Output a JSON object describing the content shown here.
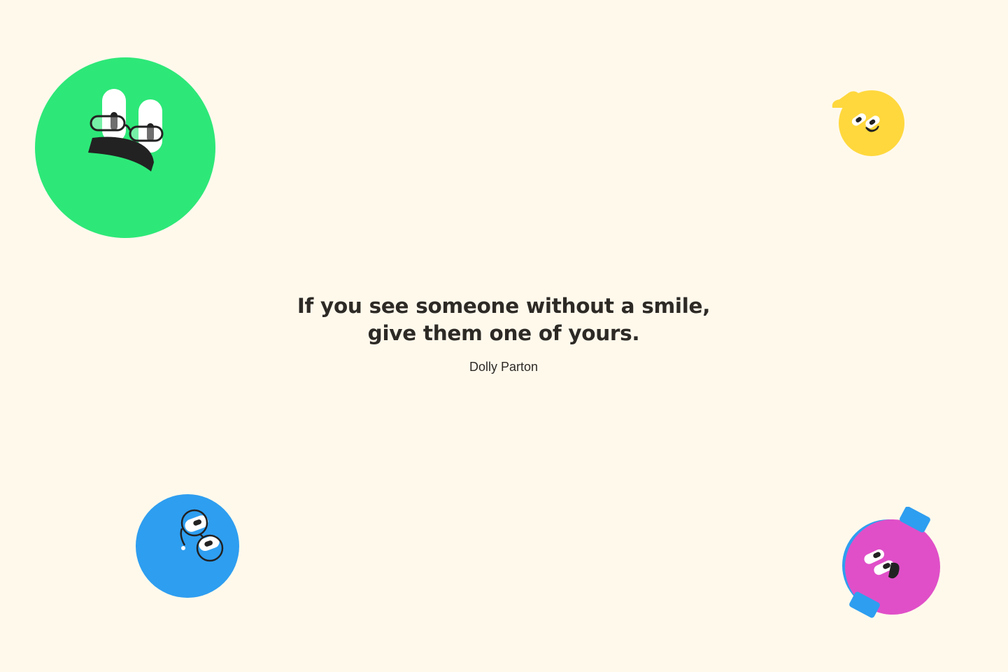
{
  "quote": {
    "lines": [
      "If you see someone without a smile,",
      "give them one of yours."
    ],
    "author": "Dolly Parton"
  },
  "characters": [
    {
      "name": "green-face-character",
      "color": "#2de878",
      "features": [
        "eyes",
        "glasses",
        "mustache"
      ]
    },
    {
      "name": "yellow-face-character",
      "color": "#ffd83d",
      "features": [
        "eyes",
        "smile",
        "hair-tuft"
      ]
    },
    {
      "name": "blue-face-character",
      "color": "#2e9ef0",
      "features": [
        "eyes",
        "glasses"
      ]
    },
    {
      "name": "pink-face-character",
      "color": "#e04fc8",
      "accent": "#2e9ef0",
      "features": [
        "eyes",
        "smile",
        "headphones"
      ]
    }
  ],
  "colors": {
    "background": "#fff9ec",
    "text": "#2d2a26"
  }
}
